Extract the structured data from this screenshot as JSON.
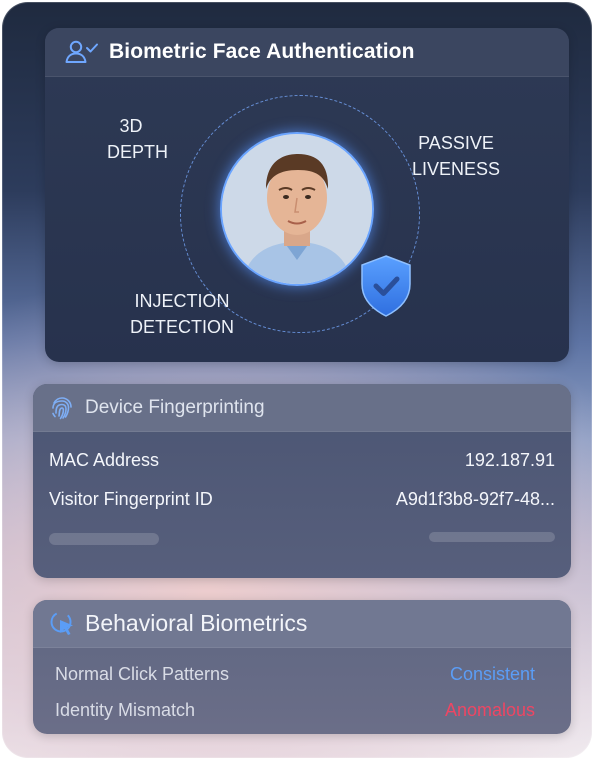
{
  "face_auth": {
    "title": "Biometric Face Authentication",
    "label_3d_line1": "3D",
    "label_3d_line2": "DEPTH",
    "label_passive_line1": "PASSIVE",
    "label_passive_line2": "LIVENESS",
    "label_injection_line1": "INJECTION",
    "label_injection_line2": "DETECTION",
    "icons": {
      "header": "user-check-icon",
      "shield": "shield-check-icon"
    },
    "accent_color": "#4a8ff5"
  },
  "device_fingerprinting": {
    "title": "Device Fingerprinting",
    "icon": "fingerprint-icon",
    "rows": [
      {
        "label": "MAC Address",
        "value": "192.187.91"
      },
      {
        "label": "Visitor Fingerprint ID",
        "value": "A9d1f3b8-92f7-48..."
      }
    ]
  },
  "behavioral_biometrics": {
    "title": "Behavioral Biometrics",
    "icon": "cursor-click-icon",
    "rows": [
      {
        "label": "Normal Click Patterns",
        "value": "Consistent",
        "status_color": "#5b9df6"
      },
      {
        "label": "Identity Mismatch",
        "value": "Anomalous",
        "status_color": "#ee4663"
      }
    ]
  }
}
